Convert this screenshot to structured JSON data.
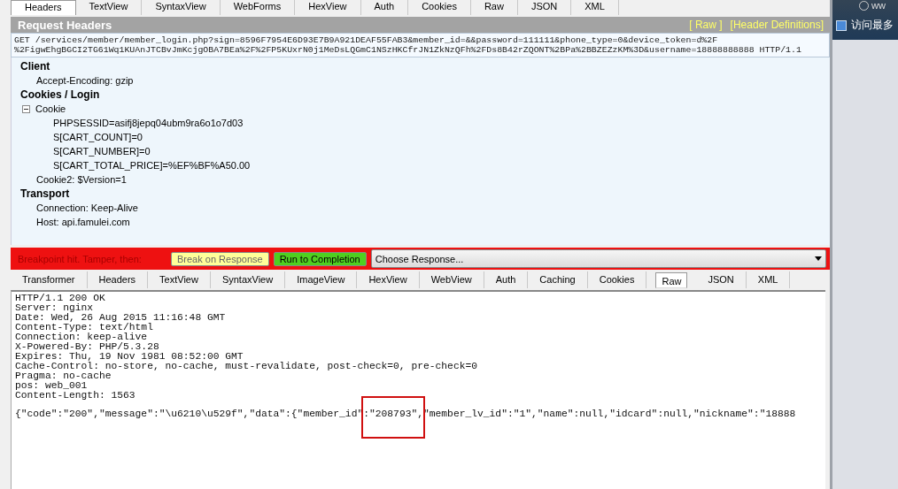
{
  "request_tabs": [
    {
      "label": "Headers",
      "selected": true
    },
    {
      "label": "TextView",
      "selected": false
    },
    {
      "label": "SyntaxView",
      "selected": false
    },
    {
      "label": "WebForms",
      "selected": false
    },
    {
      "label": "HexView",
      "selected": false
    },
    {
      "label": "Auth",
      "selected": false
    },
    {
      "label": "Cookies",
      "selected": false
    },
    {
      "label": "Raw",
      "selected": false
    },
    {
      "label": "JSON",
      "selected": false
    },
    {
      "label": "XML",
      "selected": false
    }
  ],
  "request_headers": {
    "title": "Request Headers",
    "links": [
      "[ Raw ]",
      "[Header Definitions]"
    ],
    "request_line": [
      "GET /services/member/member_login.php?sign=8596F7954E6D93E7B9A921DEAF55FAB3&member_id=&&password=111111&phone_type=0&device_token=d%2F",
      "%2FigwEhgBGCI2TG61Wq1KUAnJTCBvJmKcjgOBA7BEa%2F%2FP5KUxrN0j1MeDsLQGmC1NSzHKCfrJN1ZkNzQFh%2FDs8B42rZQONT%2BPa%2BBZEZzKM%3D&username=18888888888 HTTP/1.1"
    ],
    "groups": [
      {
        "title": "Client",
        "items": [
          {
            "text": "Accept-Encoding: gzip"
          }
        ]
      },
      {
        "title": "Cookies / Login",
        "items": [
          {
            "text": "Cookie",
            "expanded": true,
            "children": [
              {
                "text": "PHPSESSID=asifj8jepq04ubm9ra6o1o7d03"
              },
              {
                "text": "S[CART_COUNT]=0"
              },
              {
                "text": "S[CART_NUMBER]=0"
              },
              {
                "text": "S[CART_TOTAL_PRICE]=%EF%BF%A50.00"
              }
            ]
          },
          {
            "text": "Cookie2: $Version=1"
          }
        ]
      },
      {
        "title": "Transport",
        "items": [
          {
            "text": "Connection: Keep-Alive"
          },
          {
            "text": "Host: api.famulei.com"
          }
        ]
      }
    ]
  },
  "breakpoint": {
    "message": "Breakpoint hit. Tamper, then:",
    "buttons": [
      {
        "label": "Break on Response",
        "kind": "response"
      },
      {
        "label": "Run to Completion",
        "kind": "complete"
      }
    ],
    "dropdown": {
      "value": "Choose Response..."
    }
  },
  "response_tabs": [
    {
      "label": "Transformer",
      "selected": false
    },
    {
      "label": "Headers",
      "selected": false
    },
    {
      "label": "TextView",
      "selected": false
    },
    {
      "label": "SyntaxView",
      "selected": false
    },
    {
      "label": "ImageView",
      "selected": false
    },
    {
      "label": "HexView",
      "selected": false
    },
    {
      "label": "WebView",
      "selected": false
    },
    {
      "label": "Auth",
      "selected": false
    },
    {
      "label": "Caching",
      "selected": false
    },
    {
      "label": "Cookies",
      "selected": false
    },
    {
      "label": "Raw",
      "selected": true
    },
    {
      "label": "JSON",
      "selected": false
    },
    {
      "label": "XML",
      "selected": false
    }
  ],
  "response": {
    "lines": [
      "HTTP/1.1 200 OK",
      "Server: nginx",
      "Date: Wed, 26 Aug 2015 11:16:48 GMT",
      "Content-Type: text/html",
      "Connection: keep-alive",
      "X-Powered-By: PHP/5.3.28",
      "Expires: Thu, 19 Nov 1981 08:52:00 GMT",
      "Cache-Control: no-store, no-cache, must-revalidate, post-check=0, pre-check=0",
      "Pragma: no-cache",
      "pos: web_001",
      "Content-Length: 1563"
    ],
    "body": [
      {
        "text": "{\"code\":\"200\",\"message\":\"\\u6210\\u529f\",\"data\":{\"member_id\"",
        "highlighted": false
      },
      {
        "text": ":\"208793\",",
        "highlighted": true
      },
      {
        "text": "\"member_lv_id\":\"1\",\"name\":null,\"idcard\":null,\"nickname\":\"18888",
        "highlighted": false
      }
    ]
  },
  "side_panel": {
    "top_text": "ww",
    "label": "访问最多"
  }
}
